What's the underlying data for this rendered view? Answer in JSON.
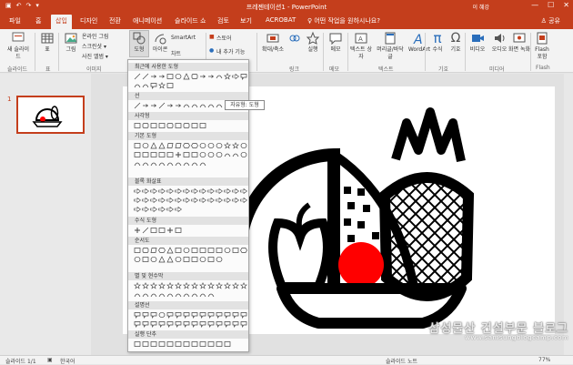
{
  "titlebar": {
    "title": "프레젠테이션1 - PowerPoint",
    "user": "이 혜강",
    "min": "—",
    "max": "☐",
    "close": "✕"
  },
  "tabs": [
    "파일",
    "홈",
    "삽입",
    "디자인",
    "전환",
    "애니메이션",
    "슬라이드 쇼",
    "검토",
    "보기",
    "ACROBAT"
  ],
  "active_tab": "삽입",
  "tellme": "♀ 어떤 작업을 원하시나요?",
  "share": "♙ 공유",
  "ribbon": {
    "new_slide": "새 슬라이드",
    "table": "표",
    "image": "그림",
    "online_image": "온라인 그림",
    "screenshot": "스크린샷 ▾",
    "photo_album": "사진 앨범 ▾",
    "shapes": "도형",
    "icons": "아이콘",
    "smartart": "SmartArt",
    "chart": "차트",
    "store": "스토어",
    "my_addins": "내 추가 기능",
    "zoom": "확대/축소",
    "link": "링크",
    "action": "실행",
    "memo": "메모",
    "textbox": "텍스트 상자",
    "header_footer": "머리글/바닥글",
    "wordart": "WordArt",
    "equation": "수식",
    "symbol": "기호",
    "video": "비디오",
    "audio": "오디오",
    "screen_record": "화면 녹화",
    "flash": "Flash 포함",
    "groups": {
      "slide": "슬라이드",
      "table": "표",
      "image": "이미지",
      "link": "링크",
      "memo": "메모",
      "text": "텍스트",
      "symbol": "기호",
      "media": "미디어",
      "flash": "Flash"
    }
  },
  "shapes_menu": {
    "sections": [
      "최근에 사용한 도형",
      "선",
      "사각형",
      "기본 도형",
      "블록 화살표",
      "수식 도형",
      "순서도",
      "별 및 현수막",
      "설명선",
      "실행 단추"
    ]
  },
  "tooltip": "자유형: 도형",
  "left_pane": {
    "slide_number": "1"
  },
  "statusbar": {
    "slide": "슬라이드 1/1",
    "language": "한국어",
    "notes": "슬라이드 노트",
    "zoom": "77%"
  },
  "watermark": {
    "line1": "삼성물산 건설부문 블로그",
    "line2": "www.samsungblogcamp.com"
  },
  "colors": {
    "accent": "#c43e1c",
    "apple": "#ff0000",
    "outline": "#000000"
  }
}
